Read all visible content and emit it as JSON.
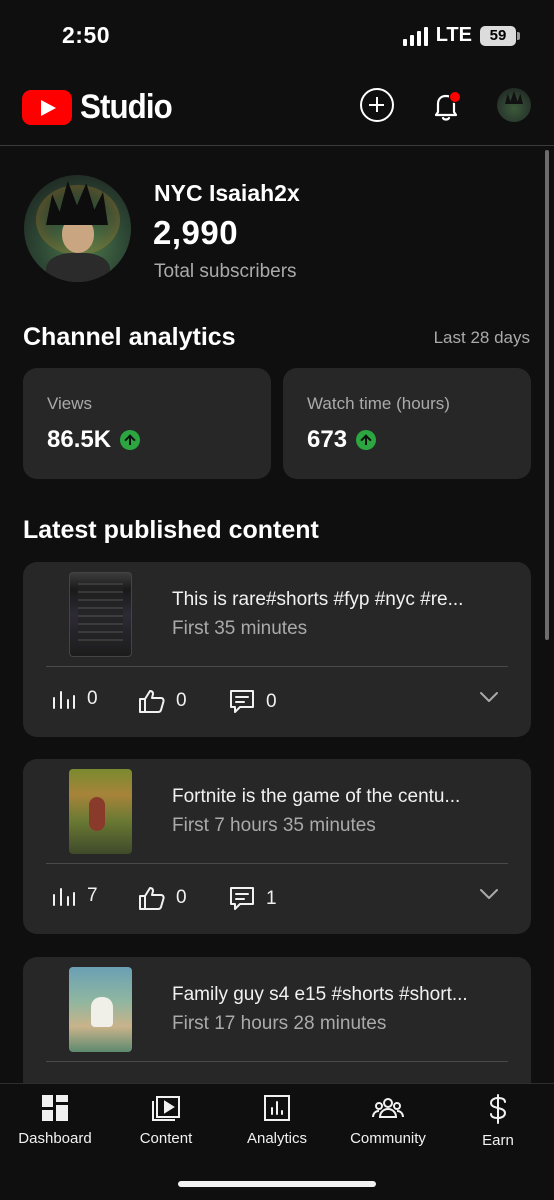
{
  "status_bar": {
    "time": "2:50",
    "network": "LTE",
    "battery": "59"
  },
  "header": {
    "logo_text": "Studio",
    "icons": [
      "create-icon",
      "bell-icon",
      "avatar"
    ],
    "notification_color": "#ff0000"
  },
  "channel": {
    "name": "NYC Isaiah2x",
    "subscribers": "2,990",
    "subscribers_label": "Total subscribers"
  },
  "analytics": {
    "title": "Channel analytics",
    "range": "Last 28 days",
    "metrics": [
      {
        "label": "Views",
        "value": "86.5K",
        "trend": "up"
      },
      {
        "label": "Watch time (hours)",
        "value": "673",
        "trend": "up"
      }
    ],
    "trend_color": "#2ba640"
  },
  "latest": {
    "title": "Latest published content",
    "items": [
      {
        "title": "This is rare#shorts #fyp #nyc #re...",
        "subtitle": "First 35 minutes",
        "views": "0",
        "likes": "0",
        "comments": "0"
      },
      {
        "title": "Fortnite is the game of the centu...",
        "subtitle": "First 7 hours 35 minutes",
        "views": "7",
        "likes": "0",
        "comments": "1"
      },
      {
        "title": "Family guy s4 e15 #shorts #short...",
        "subtitle": "First 17 hours 28 minutes",
        "views": "",
        "likes": "",
        "comments": ""
      }
    ]
  },
  "bottom_nav": {
    "items": [
      {
        "label": "Dashboard",
        "icon": "dashboard-icon"
      },
      {
        "label": "Content",
        "icon": "content-icon"
      },
      {
        "label": "Analytics",
        "icon": "analytics-icon"
      },
      {
        "label": "Community",
        "icon": "community-icon"
      },
      {
        "label": "Earn",
        "icon": "dollar-icon"
      }
    ]
  }
}
